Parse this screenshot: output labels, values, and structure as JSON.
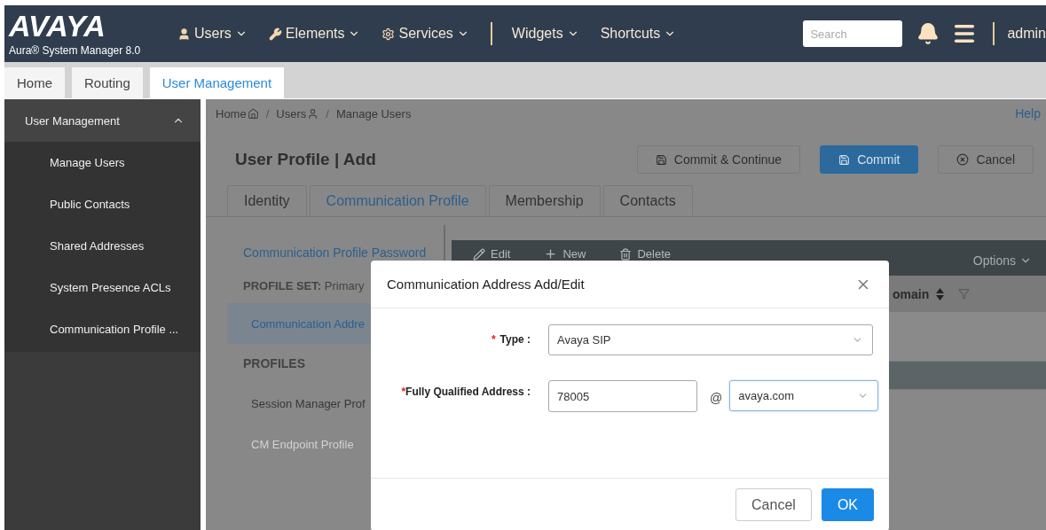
{
  "header": {
    "logo": "AVAYA",
    "product": "Aura® System Manager 8.0",
    "menus": [
      "Users",
      "Elements",
      "Services",
      "Widgets",
      "Shortcuts"
    ],
    "search": {
      "placeholder": "Search"
    },
    "user": "admin"
  },
  "app_tabs": [
    {
      "label": "Home",
      "selected": false
    },
    {
      "label": "Routing",
      "selected": false
    },
    {
      "label": "User Management",
      "selected": true
    }
  ],
  "sidebar": {
    "title": "User Management",
    "expanded": true,
    "items": [
      "Manage Users",
      "Public Contacts",
      "Shared Addresses",
      "System Presence ACLs",
      "Communication Profile ..."
    ]
  },
  "breadcrumb": {
    "items": [
      "Home",
      "Users",
      "Manage Users"
    ],
    "separator": "/"
  },
  "help": "Help",
  "page_title": "User Profile | Add",
  "actions": [
    {
      "label": "Commit & Continue",
      "primary": false
    },
    {
      "label": "Commit",
      "primary": true
    },
    {
      "label": "Cancel",
      "primary": false
    }
  ],
  "profile_tabs": [
    {
      "label": "Identity",
      "selected": false
    },
    {
      "label": "Communication Profile",
      "selected": true
    },
    {
      "label": "Membership",
      "selected": false
    },
    {
      "label": "Contacts",
      "selected": false
    }
  ],
  "profile_nav": [
    {
      "kind": "link",
      "label": "Communication Profile Password"
    },
    {
      "kind": "info",
      "label": "**PROFILE SET:** Primary"
    },
    {
      "kind": "item",
      "label": "Communication Addre",
      "selected": true,
      "disabled": false
    },
    {
      "kind": "heading",
      "label": "PROFILES"
    },
    {
      "kind": "item",
      "label": "Session Manager Prof",
      "selected": false,
      "disabled": false
    },
    {
      "kind": "item",
      "label": "CM Endpoint Profile",
      "selected": false,
      "disabled": true
    }
  ],
  "toolbar": [
    "Edit",
    "New",
    "Delete"
  ],
  "options": "Options",
  "table": {
    "columns": [
      {
        "label": "omain",
        "sortable": true,
        "filterable": true
      }
    ],
    "rows": [
      {
        "selected": false
      },
      {
        "selected": true
      }
    ]
  },
  "dialog": {
    "title": "Communication Address Add/Edit",
    "fields": [
      {
        "kind": "select",
        "mark": "*",
        "label": "Type :",
        "value": "Avaya SIP"
      },
      {
        "kind": "address",
        "mark": "*",
        "label": "Fully Qualified Address :",
        "value": "78005",
        "separator": "@",
        "domain": "avaya.com"
      }
    ],
    "buttons": [
      {
        "label": "Cancel",
        "primary": false
      },
      {
        "label": "OK",
        "primary": true
      }
    ]
  }
}
